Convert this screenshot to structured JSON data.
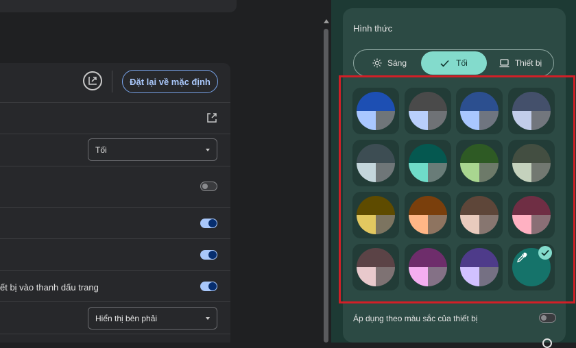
{
  "settings": {
    "reset_label": "Đặt lại về mặc định",
    "select1": "Tối",
    "row6_text": "ết bị vào thanh dấu trang",
    "select2": "Hiển thị bên phải",
    "toggles": [
      "off",
      "on",
      "on",
      "on"
    ]
  },
  "appearance": {
    "title": "Hình thức",
    "modes": [
      {
        "label": "Sáng",
        "icon": "sun-icon",
        "selected": false
      },
      {
        "label": "Tối",
        "icon": "check-icon",
        "selected": true
      },
      {
        "label": "Thiết bị",
        "icon": "monitor-icon",
        "selected": false
      }
    ],
    "swatches": [
      {
        "top": "#1d4fb3",
        "left": "#a9c7ff",
        "right": "#6f7579"
      },
      {
        "top": "#4a4a4a",
        "left": "#b9cffb",
        "right": "#6f7276"
      },
      {
        "top": "#2c4f8f",
        "left": "#a9c7ff",
        "right": "#6f7580"
      },
      {
        "top": "#44506b",
        "left": "#c2cdea",
        "right": "#72767d"
      },
      {
        "top": "#3d4d53",
        "left": "#c4d6dc",
        "right": "#6f7678"
      },
      {
        "top": "#055850",
        "left": "#6fdcc9",
        "right": "#697c78"
      },
      {
        "top": "#2e5a24",
        "left": "#a9d690",
        "right": "#6d7a69"
      },
      {
        "top": "#434e41",
        "left": "#c5d2bd",
        "right": "#727871"
      },
      {
        "top": "#5e4b00",
        "left": "#e2c860",
        "right": "#7c7460"
      },
      {
        "top": "#7a3f0c",
        "left": "#ffb686",
        "right": "#8e7460"
      },
      {
        "top": "#5e4639",
        "left": "#e9cbbd",
        "right": "#877670"
      },
      {
        "top": "#6f2e44",
        "left": "#ffb1c2",
        "right": "#8a6f76"
      },
      {
        "top": "#5b4346",
        "left": "#e8c9cc",
        "right": "#7e7273"
      },
      {
        "top": "#6e2d6b",
        "left": "#f4aef0",
        "right": "#847186"
      },
      {
        "top": "#4e3b8a",
        "left": "#d1c1ff",
        "right": "#757083"
      }
    ],
    "custom_icon": "eyedropper-icon",
    "selected_badge": "check-icon",
    "apply_device_label": "Áp dụng theo màu sắc của thiết bị"
  },
  "colors": {
    "accent": "#83dbcc",
    "highlight_frame": "#d21f27",
    "toggle_on": "#a8c7fa",
    "link_blue": "#a9c7fa"
  }
}
